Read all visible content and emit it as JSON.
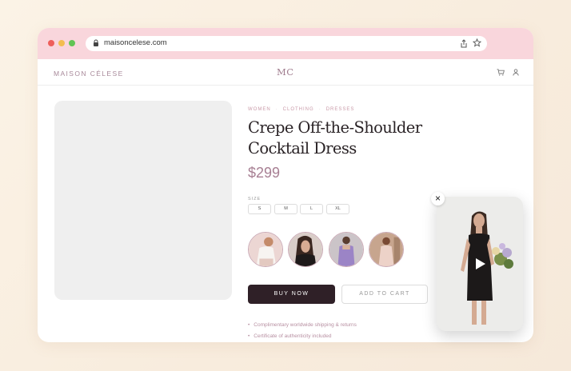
{
  "browser": {
    "url": "maisoncelese.com"
  },
  "header": {
    "brand": "MAISON CÉLESE",
    "logo": "MC"
  },
  "product": {
    "breadcrumb": [
      "WOMEN",
      "CLOTHING",
      "DRESSES"
    ],
    "title": "Crepe Off-the-Shoulder Cocktail Dress",
    "price": "$299",
    "size_label": "SIZE",
    "sizes": [
      "S",
      "M",
      "L",
      "XL"
    ],
    "buy_label": "BUY NOW",
    "cart_label": "ADD TO CART",
    "perks": [
      "Complimentary worldwide shipping & returns",
      "Certificate of authenticity included"
    ]
  },
  "video_popup": {
    "close_symbol": "×"
  },
  "colors": {
    "accent": "#a77f93",
    "chrome": "#f9d6dc",
    "buy_button": "#2f2027"
  },
  "icons": [
    "lock-icon",
    "share-icon",
    "star-icon",
    "cart-icon",
    "user-icon",
    "play-icon",
    "close-icon"
  ]
}
